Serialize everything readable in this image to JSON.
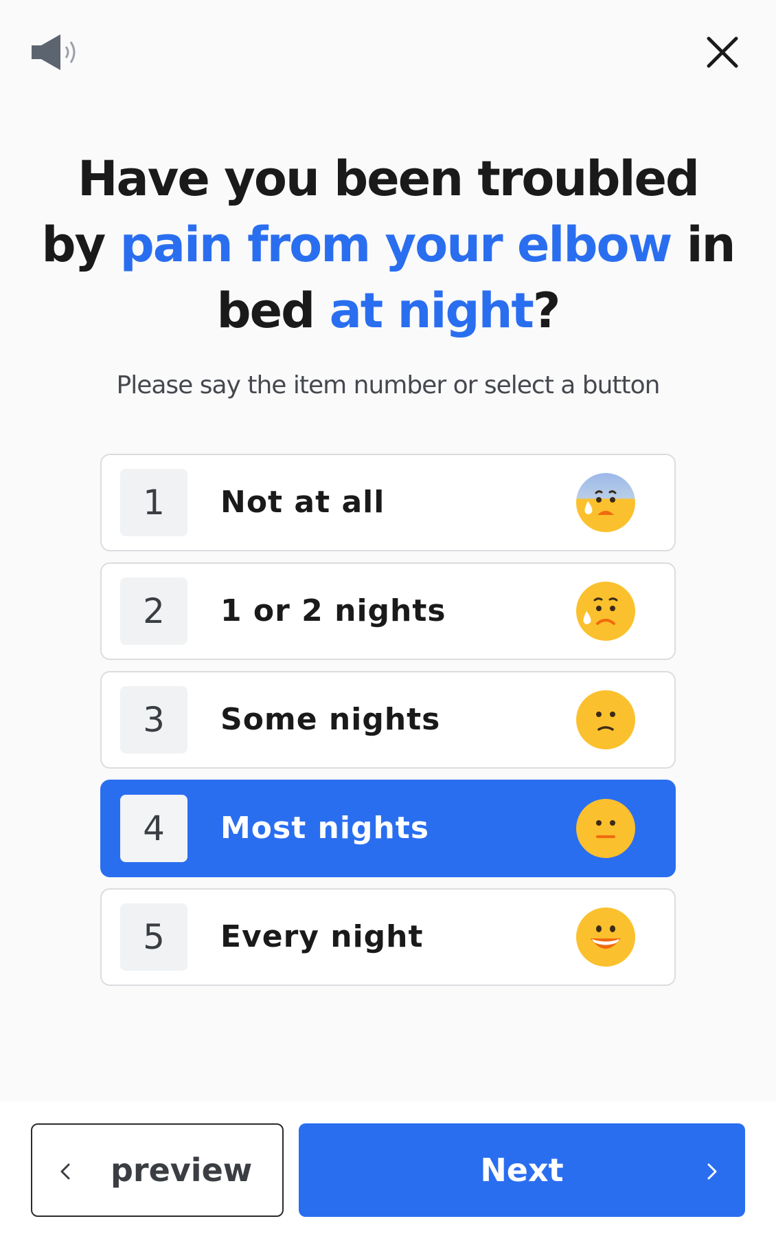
{
  "header": {
    "speaker_icon": "speaker-icon",
    "close_icon": "close-icon"
  },
  "question": {
    "part1": "Have you been troubled by ",
    "highlight1": "pain from your elbow",
    "part2": " in bed ",
    "highlight2": "at night",
    "part3": "?"
  },
  "instruction": "Please say the item number or select a button",
  "options": [
    {
      "number": "1",
      "label": "Not at all",
      "emoji": "anxious-sweat-face-icon"
    },
    {
      "number": "2",
      "label": "1 or 2 nights",
      "emoji": "sad-tear-face-icon"
    },
    {
      "number": "3",
      "label": "Some nights",
      "emoji": "confused-face-icon"
    },
    {
      "number": "4",
      "label": "Most nights",
      "emoji": "neutral-face-icon",
      "selected": true
    },
    {
      "number": "5",
      "label": "Every night",
      "emoji": "grinning-face-icon"
    }
  ],
  "footer": {
    "prev_label": "preview",
    "next_label": "Next"
  },
  "colors": {
    "accent": "#2a6ef0",
    "emoji_yellow": "#fbc02d",
    "emoji_blue_top": "#9cb8e8",
    "emoji_mouth": "#f06a0f"
  }
}
